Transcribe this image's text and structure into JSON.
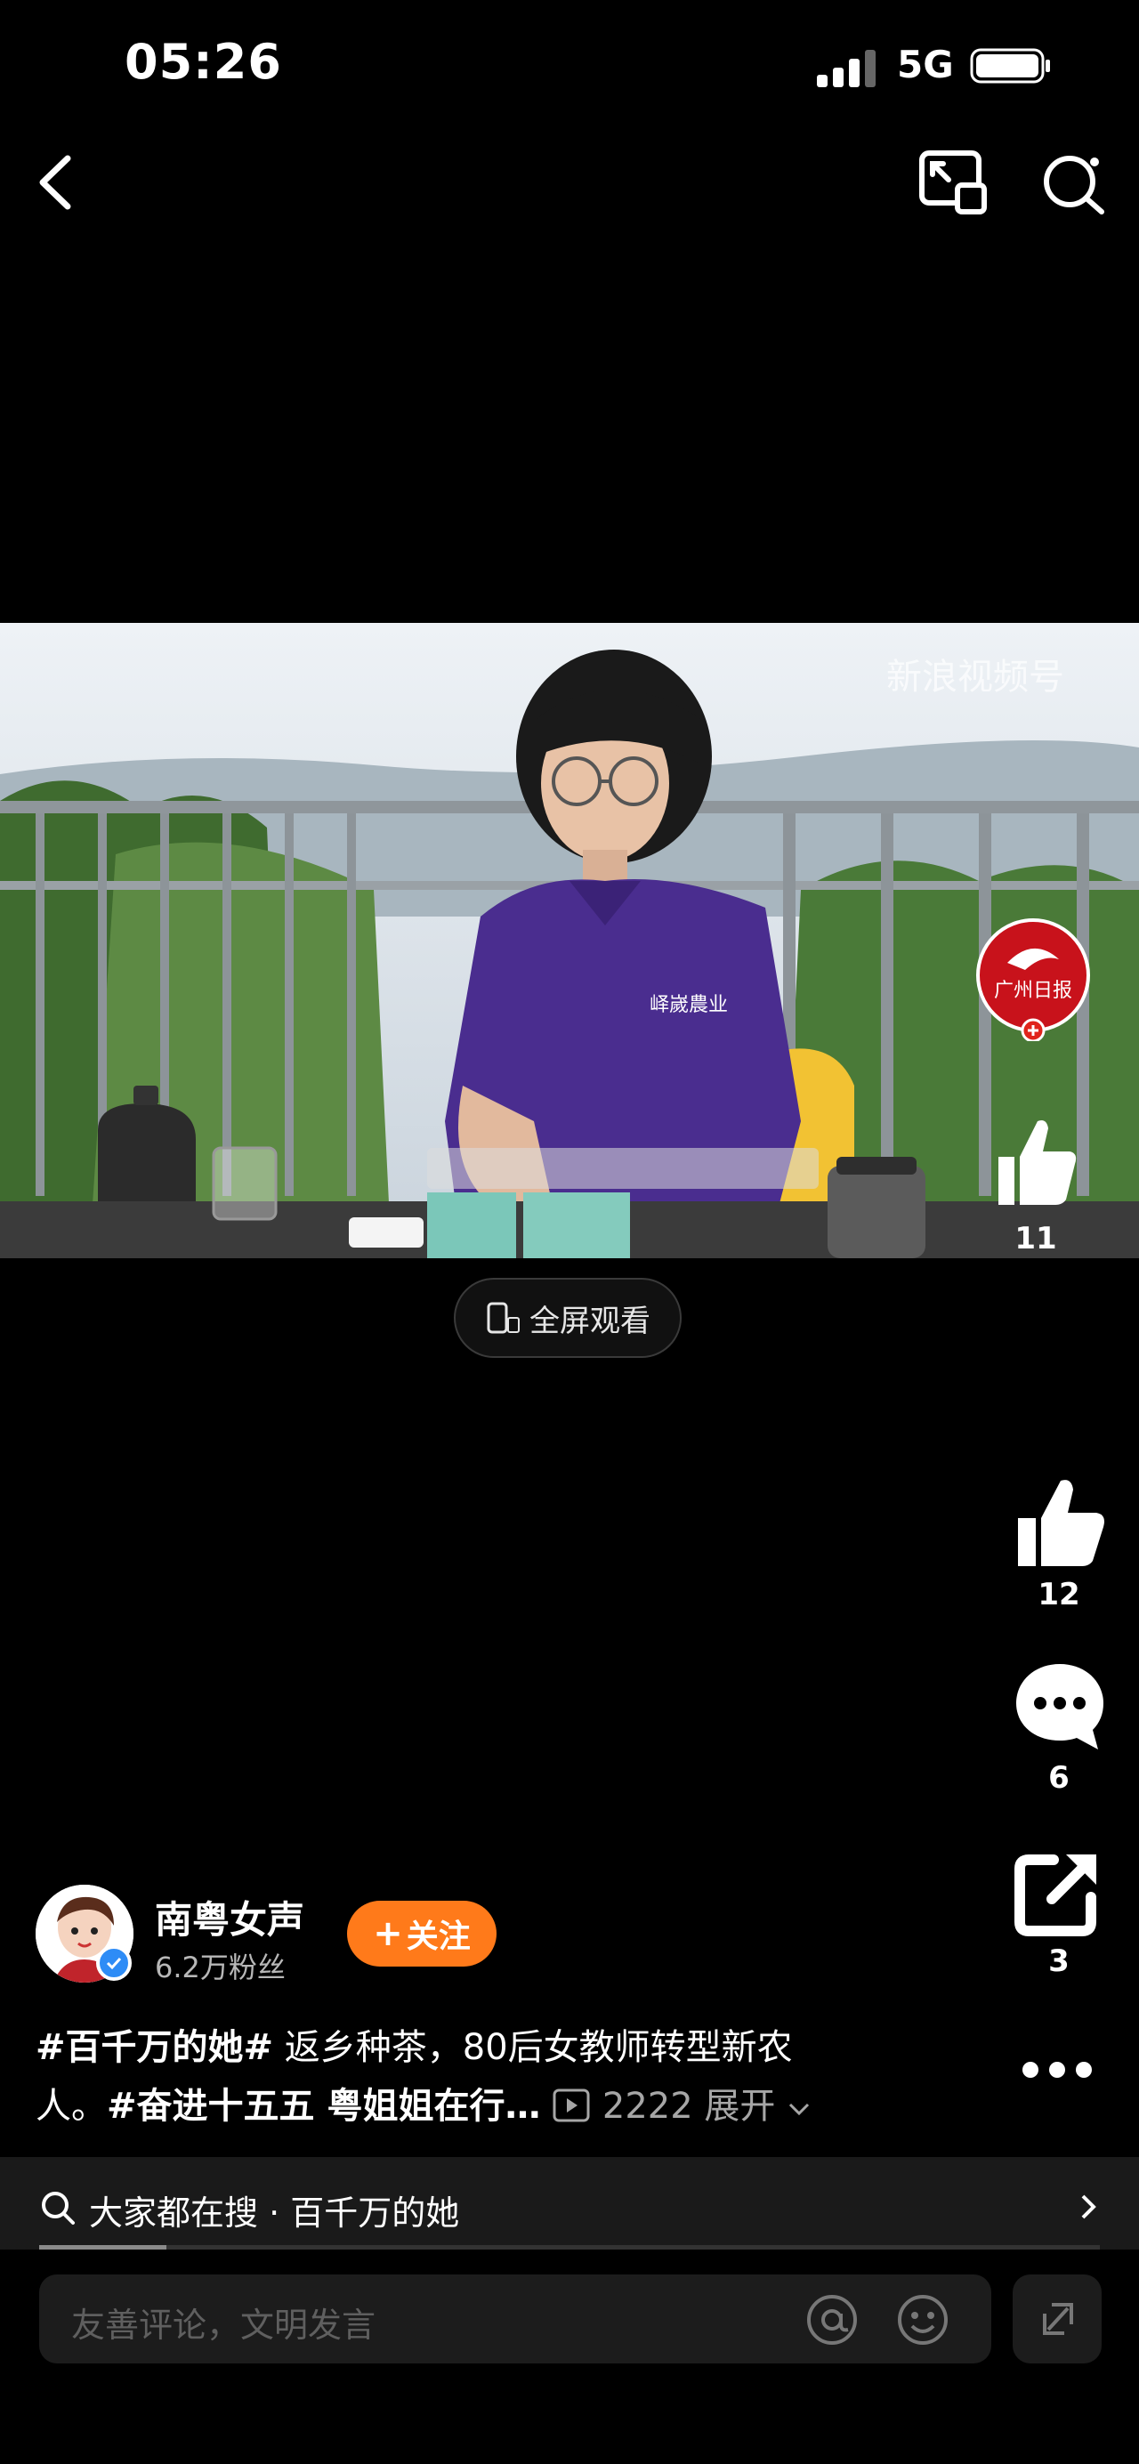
{
  "status_bar": {
    "time": "05:26",
    "network": "5G"
  },
  "video": {
    "watermark": "新浪视频号",
    "inner_like_count": "11",
    "publisher_logo_text": "广州日报",
    "fullscreen_label": "全屏观看"
  },
  "actions": {
    "like_count": "12",
    "comment_count": "6",
    "share_count": "3"
  },
  "author": {
    "name": "南粤女声",
    "fans": "6.2万粉丝",
    "follow_label": "关注"
  },
  "caption": {
    "hashtag1": "#百千万的她#",
    "line1_text": " 返乡种茶，80后女教师转型新农",
    "line2_text": "人。",
    "hashtag2": "#奋进十五五 粤姐姐在行…",
    "views": "2222",
    "expand": "展开"
  },
  "hot_search": {
    "prefix": "大家都在搜",
    "separator": "·",
    "term": "百千万的她",
    "progress": 0.12
  },
  "comment_input": {
    "placeholder": "友善评论，文明发言"
  },
  "colors": {
    "accent_orange": "#ff7a1a",
    "verified_blue": "#2e8cf6",
    "background": "#000000"
  }
}
